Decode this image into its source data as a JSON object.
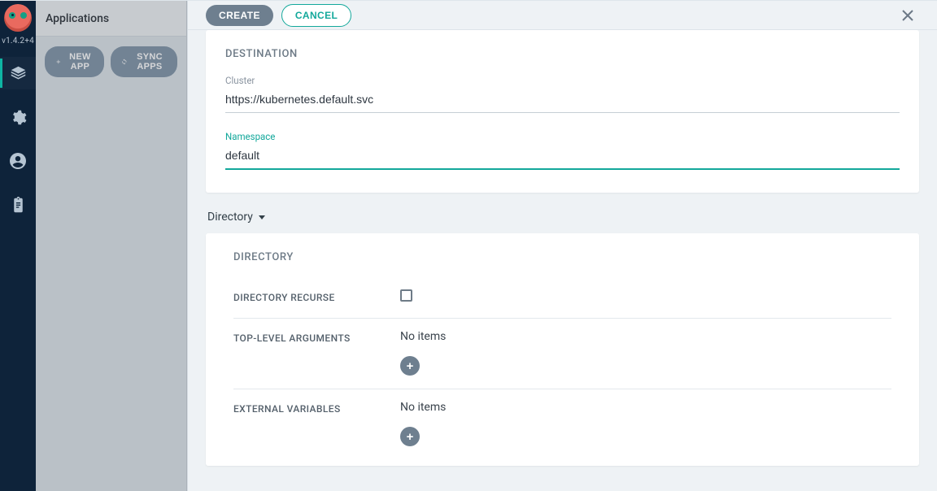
{
  "sidebar": {
    "version": "v1.4.2+4"
  },
  "apps_panel": {
    "title": "Applications",
    "new_app_label": "NEW APP",
    "sync_apps_label": "SYNC APPS"
  },
  "drawer": {
    "create_label": "CREATE",
    "cancel_label": "CANCEL",
    "destination": {
      "section_title": "DESTINATION",
      "cluster_label": "Cluster",
      "cluster_value": "https://kubernetes.default.svc",
      "namespace_label": "Namespace",
      "namespace_value": "default"
    },
    "source_type_label": "Directory",
    "directory": {
      "section_title": "DIRECTORY",
      "recurse_label": "DIRECTORY RECURSE",
      "tla_label": "TOP-LEVEL ARGUMENTS",
      "tla_empty": "No items",
      "ext_label": "EXTERNAL VARIABLES",
      "ext_empty": "No items"
    }
  }
}
